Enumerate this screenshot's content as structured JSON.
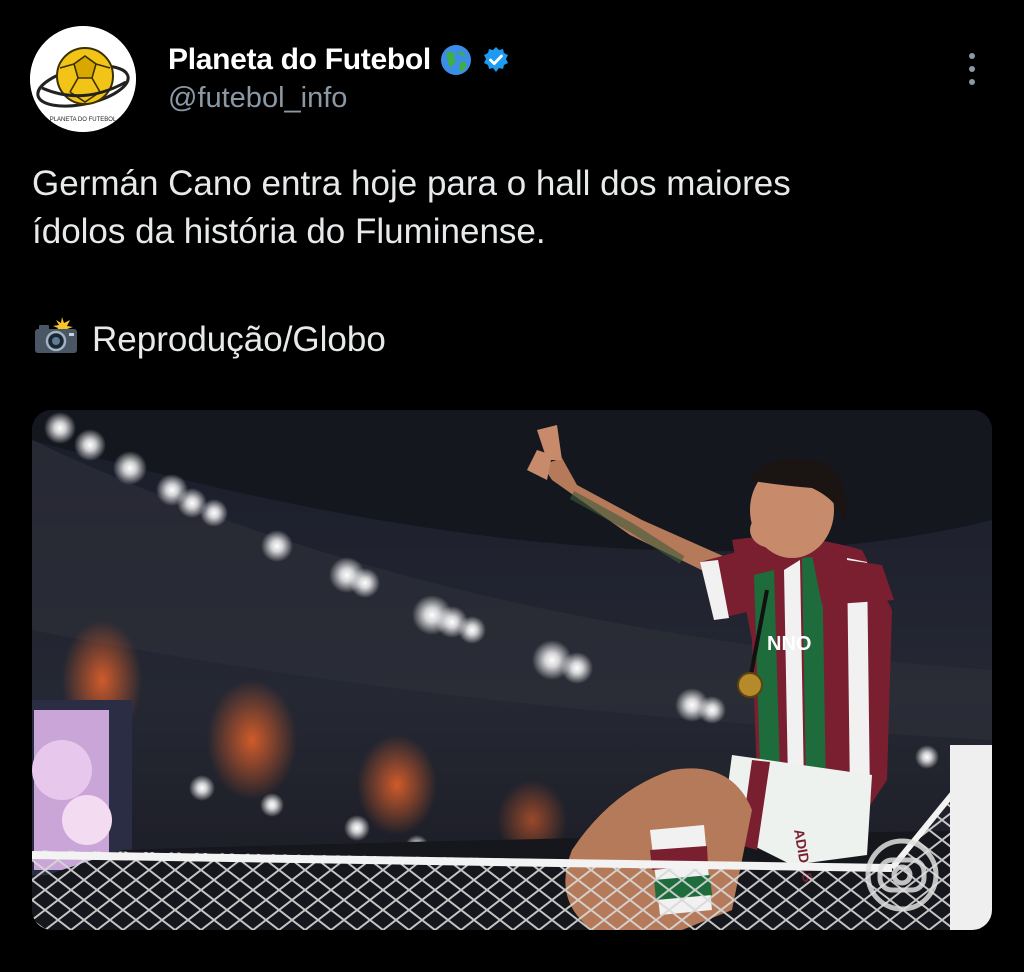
{
  "account": {
    "display_name": "Planeta do Futebol",
    "handle": "@futebol_info",
    "avatar_text": "PLANETA DO FUTEBOL",
    "name_emoji": "globe-icon",
    "verified": "verified-badge-icon"
  },
  "tweet": {
    "line1": "Germán Cano entra hoje para o hall dos maiores",
    "line2": "ídolos da história do Fluminense.",
    "credit": "Reprodução/Globo",
    "credit_emoji": "camera-flash-icon"
  },
  "media": {
    "shirt_text": "NNO",
    "shorts_text": "ADIDAS",
    "watermark": "globo-logo-icon"
  },
  "colors": {
    "background": "#000000",
    "text": "#e7e9ea",
    "muted": "#8b98a5",
    "verified_blue": "#1d9bf0"
  }
}
